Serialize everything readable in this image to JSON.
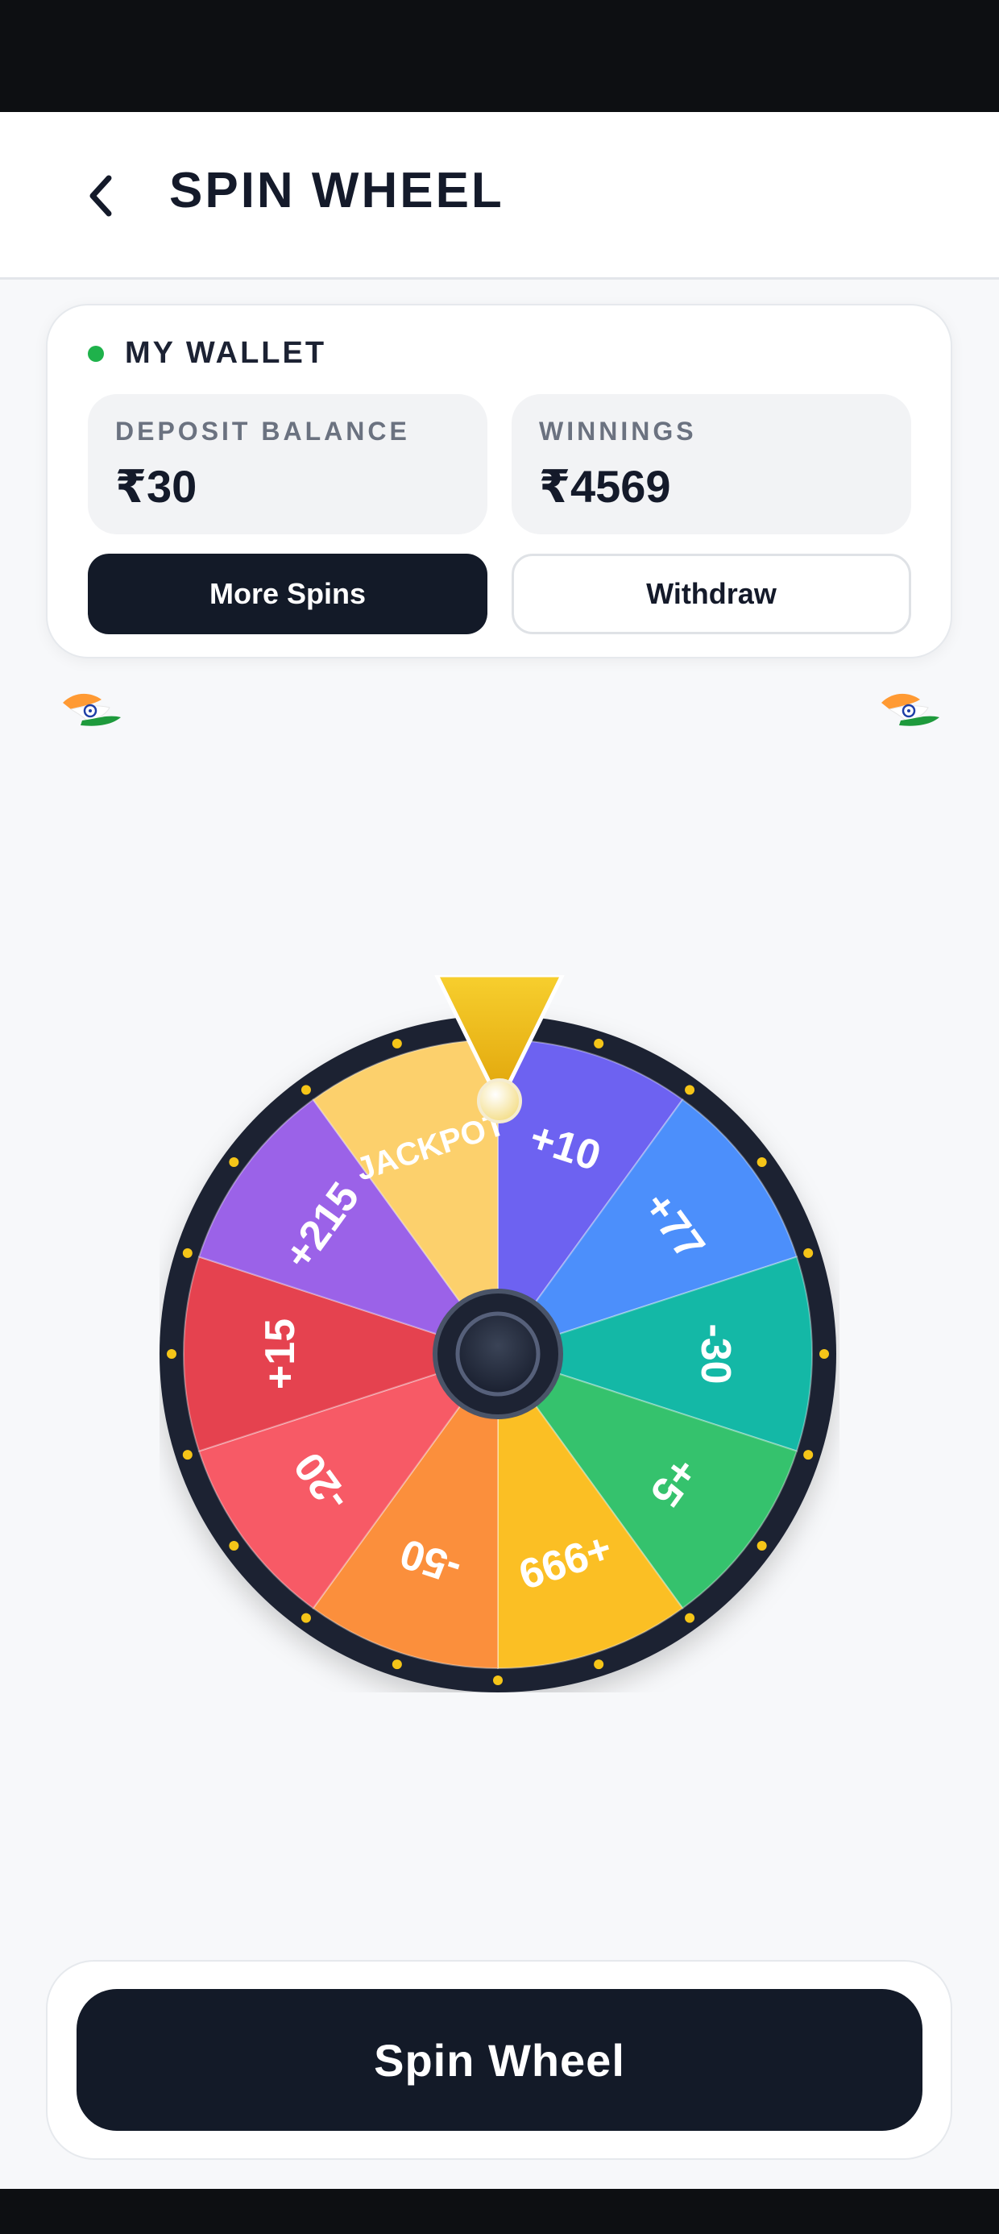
{
  "header": {
    "title": "SPIN WHEEL",
    "back_icon": "chevron-left-icon"
  },
  "wallet": {
    "title": "MY WALLET",
    "status_color": "#1fb24b",
    "deposit": {
      "label": "DEPOSIT BALANCE",
      "value": "₹30"
    },
    "winnings": {
      "label": "WINNINGS",
      "value": "₹4569"
    },
    "more_spins_label": "More Spins",
    "withdraw_label": "Withdraw"
  },
  "decorations": {
    "flag_icon": "india-flag-icon"
  },
  "wheel": {
    "pointer_color": "#f2c21b",
    "segments": [
      {
        "label": "+10",
        "color": "#6d62f1"
      },
      {
        "label": "+77",
        "color": "#4c8ffb"
      },
      {
        "label": "-30",
        "color": "#14b8a6"
      },
      {
        "label": "+5",
        "color": "#35c26d"
      },
      {
        "label": "+999",
        "color": "#fbbf24"
      },
      {
        "label": "-50",
        "color": "#fb8f3c"
      },
      {
        "label": "-20",
        "color": "#f75a66"
      },
      {
        "label": "+15",
        "color": "#e5424f"
      },
      {
        "label": "+215",
        "color": "#9b62e8"
      },
      {
        "label": "JACKPOT",
        "color": "#fcd06c"
      }
    ]
  },
  "actions": {
    "spin_label": "Spin Wheel"
  }
}
